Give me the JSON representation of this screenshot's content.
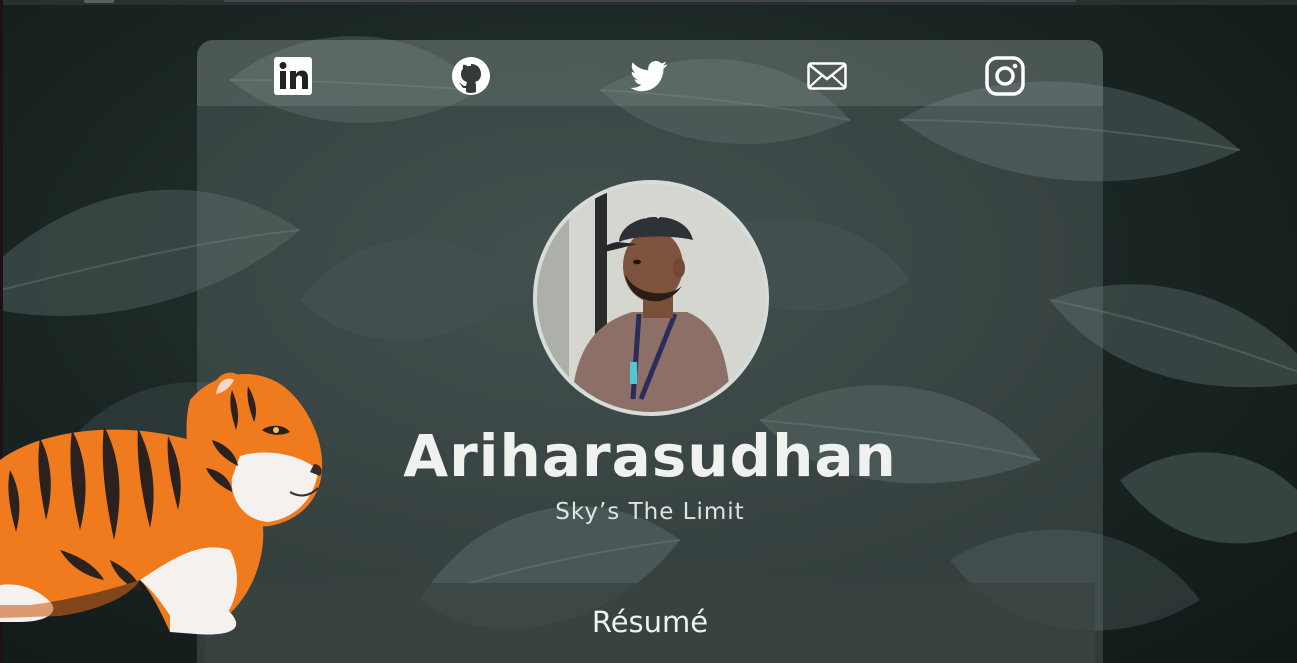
{
  "profile": {
    "name": "Ariharasudhan",
    "tagline": "Sky’s The Limit"
  },
  "social": [
    {
      "icon": "linkedin-icon"
    },
    {
      "icon": "github-icon"
    },
    {
      "icon": "twitter-icon"
    },
    {
      "icon": "mail-icon"
    },
    {
      "icon": "instagram-icon"
    }
  ],
  "resume": {
    "label": "Résumé"
  },
  "colors": {
    "background": "#1a2523",
    "leaf": "#3c4c4a",
    "card": "#78868433",
    "text": "#f0f2f0",
    "tiger_orange": "#f07a1e"
  }
}
